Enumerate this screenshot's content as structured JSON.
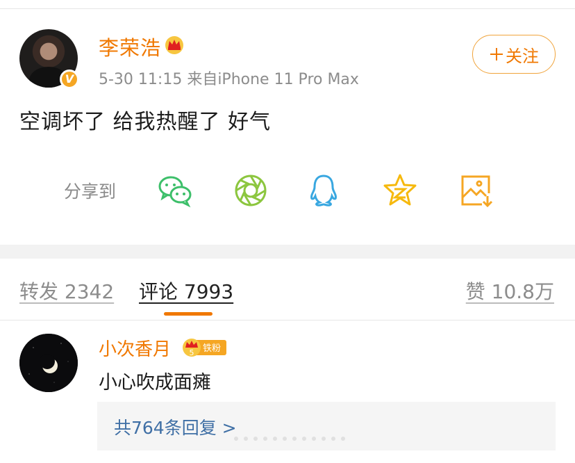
{
  "post": {
    "author": "李荣浩",
    "meta": "5-30 11:15  来自iPhone 11 Pro Max",
    "follow_label": "关注",
    "follow_icon": "plus-icon",
    "text": "空调坏了 给我热醒了 好气"
  },
  "share": {
    "label": "分享到",
    "targets": [
      {
        "icon": "wechat-icon",
        "color": "#3dbf6a"
      },
      {
        "icon": "moments-icon",
        "color": "#8cc63f"
      },
      {
        "icon": "qq-icon",
        "color": "#39a7e0"
      },
      {
        "icon": "qzone-icon",
        "color": "#f6b90e"
      },
      {
        "icon": "save-image-icon",
        "color": "#f5a623"
      }
    ]
  },
  "tabs": {
    "repost": "转发 2342",
    "comments": "评论 7993",
    "likes": "赞 10.8万"
  },
  "comment": {
    "author": "小次香月",
    "badge_level": "5",
    "badge_text": "铁粉",
    "text": "小心吹成面瘫",
    "replies_link": "共764条回复 >"
  },
  "colors": {
    "accent": "#f07800",
    "link": "#3f6fa5",
    "muted": "#8c8c8c"
  }
}
